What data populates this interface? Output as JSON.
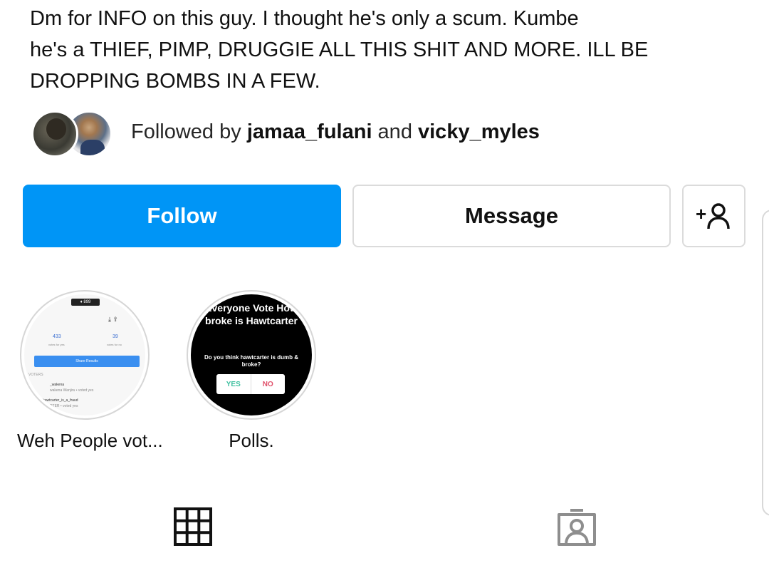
{
  "profile": {
    "bio_lines": [
      "Dm for INFO on this guy. I thought he's only a scum. Kumbe",
      "he's a THIEF, PIMP, DRUGGIE ALL THIS SHIT AND MORE. ILL BE",
      "DROPPING BOMBS IN A FEW."
    ],
    "followed_by": {
      "prefix": "Followed by ",
      "user1": "jamaa_fulani",
      "conjunction": " and ",
      "user2": "vicky_myles"
    }
  },
  "actions": {
    "follow_label": "Follow",
    "message_label": "Message",
    "suggest_icon": "person-add-icon"
  },
  "highlights": [
    {
      "label": "Weh People vot...",
      "cover": {
        "top_badge": "♦ 899",
        "count_yes": "433",
        "count_yes_sub": "votes for yes",
        "count_no": "39",
        "count_no_sub": "votes for no",
        "share_label": "Share Results",
        "voters_label": "VOTERS",
        "voter1_name": "_wakena",
        "voter1_sub": "wakena Wanjiru • voted yes",
        "voter2_name": "hawtcarter_is_a_fraud",
        "voter2_sub": "TCARTER • voted yes"
      }
    },
    {
      "label": "Polls.",
      "cover": {
        "title": "Everyone Vote How broke is Hawtcarter",
        "question": "Do you think hawtcarter is dumb & broke?",
        "yes": "YES",
        "no": "NO"
      }
    }
  ],
  "tabs": [
    {
      "name": "posts-grid",
      "icon": "grid-icon",
      "active": true
    },
    {
      "name": "tagged",
      "icon": "tagged-person-icon",
      "active": false
    }
  ],
  "colors": {
    "accent": "#0095f6",
    "border": "#dbdbdb",
    "text": "#262626"
  }
}
